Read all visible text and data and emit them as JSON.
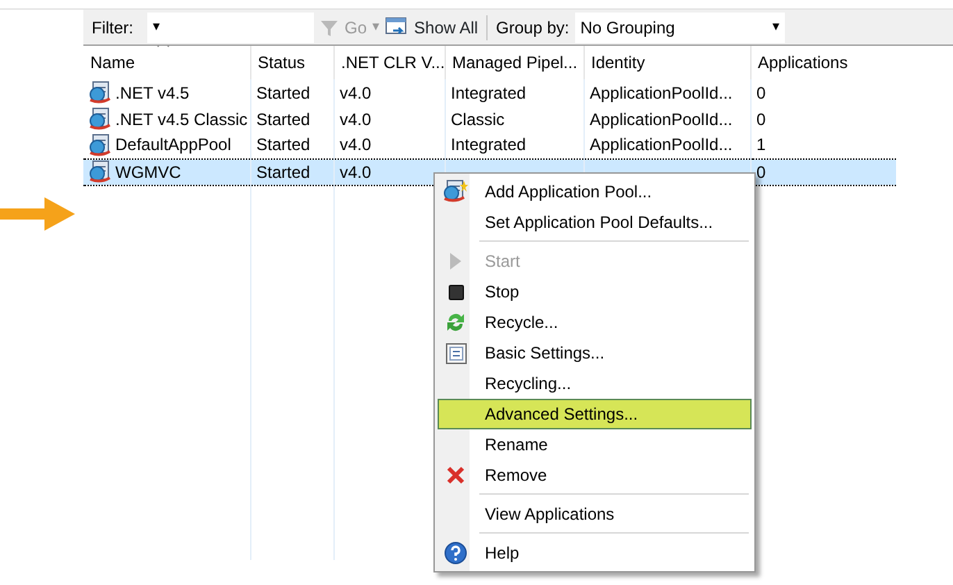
{
  "toolbar": {
    "filter_label": "Filter:",
    "filter_caret": "▾",
    "go": {
      "label": "Go",
      "disabled": true
    },
    "go_caret": "▾",
    "show_all": "Show All",
    "group_label": "Group by:",
    "group_value": "No Grouping",
    "group_caret": "▾"
  },
  "table": {
    "columns": [
      "Name",
      "Status",
      ".NET CLR V...",
      "Managed Pipel...",
      "Identity",
      "Applications"
    ],
    "rows": [
      {
        "selected": false,
        "cells": [
          ".NET v4.5",
          "Started",
          "v4.0",
          "Integrated",
          "ApplicationPoolId...",
          "0"
        ]
      },
      {
        "selected": false,
        "cells": [
          ".NET v4.5 Classic",
          "Started",
          "v4.0",
          "Classic",
          "ApplicationPoolId...",
          "0"
        ]
      },
      {
        "selected": false,
        "cells": [
          "DefaultAppPool",
          "Started",
          "v4.0",
          "Integrated",
          "ApplicationPoolId...",
          "1"
        ]
      },
      {
        "selected": true,
        "cells": [
          "WGMVC",
          "Started",
          "v4.0",
          null,
          null,
          "0"
        ]
      }
    ]
  },
  "context_menu": [
    {
      "kind": "item",
      "label": "Add Application Pool...",
      "disabled": false,
      "selected": false
    },
    {
      "kind": "item",
      "label": "Set Application Pool Defaults...",
      "disabled": false,
      "selected": false
    },
    {
      "kind": "separator"
    },
    {
      "kind": "item",
      "label": "Start",
      "disabled": true,
      "selected": false
    },
    {
      "kind": "item",
      "label": "Stop",
      "disabled": false,
      "selected": false
    },
    {
      "kind": "item",
      "label": "Recycle...",
      "disabled": false,
      "selected": false
    },
    {
      "kind": "item",
      "label": "Basic Settings...",
      "disabled": false,
      "selected": false
    },
    {
      "kind": "item",
      "label": "Recycling...",
      "disabled": false,
      "selected": false
    },
    {
      "kind": "item",
      "label": "Advanced Settings...",
      "disabled": false,
      "selected": true
    },
    {
      "kind": "item",
      "label": "Rename",
      "disabled": false,
      "selected": false
    },
    {
      "kind": "item",
      "label": "Remove",
      "disabled": false,
      "selected": false
    },
    {
      "kind": "separator"
    },
    {
      "kind": "item",
      "label": "View Applications",
      "disabled": false,
      "selected": false
    },
    {
      "kind": "separator"
    },
    {
      "kind": "item",
      "label": "Help",
      "disabled": false,
      "selected": false
    }
  ]
}
